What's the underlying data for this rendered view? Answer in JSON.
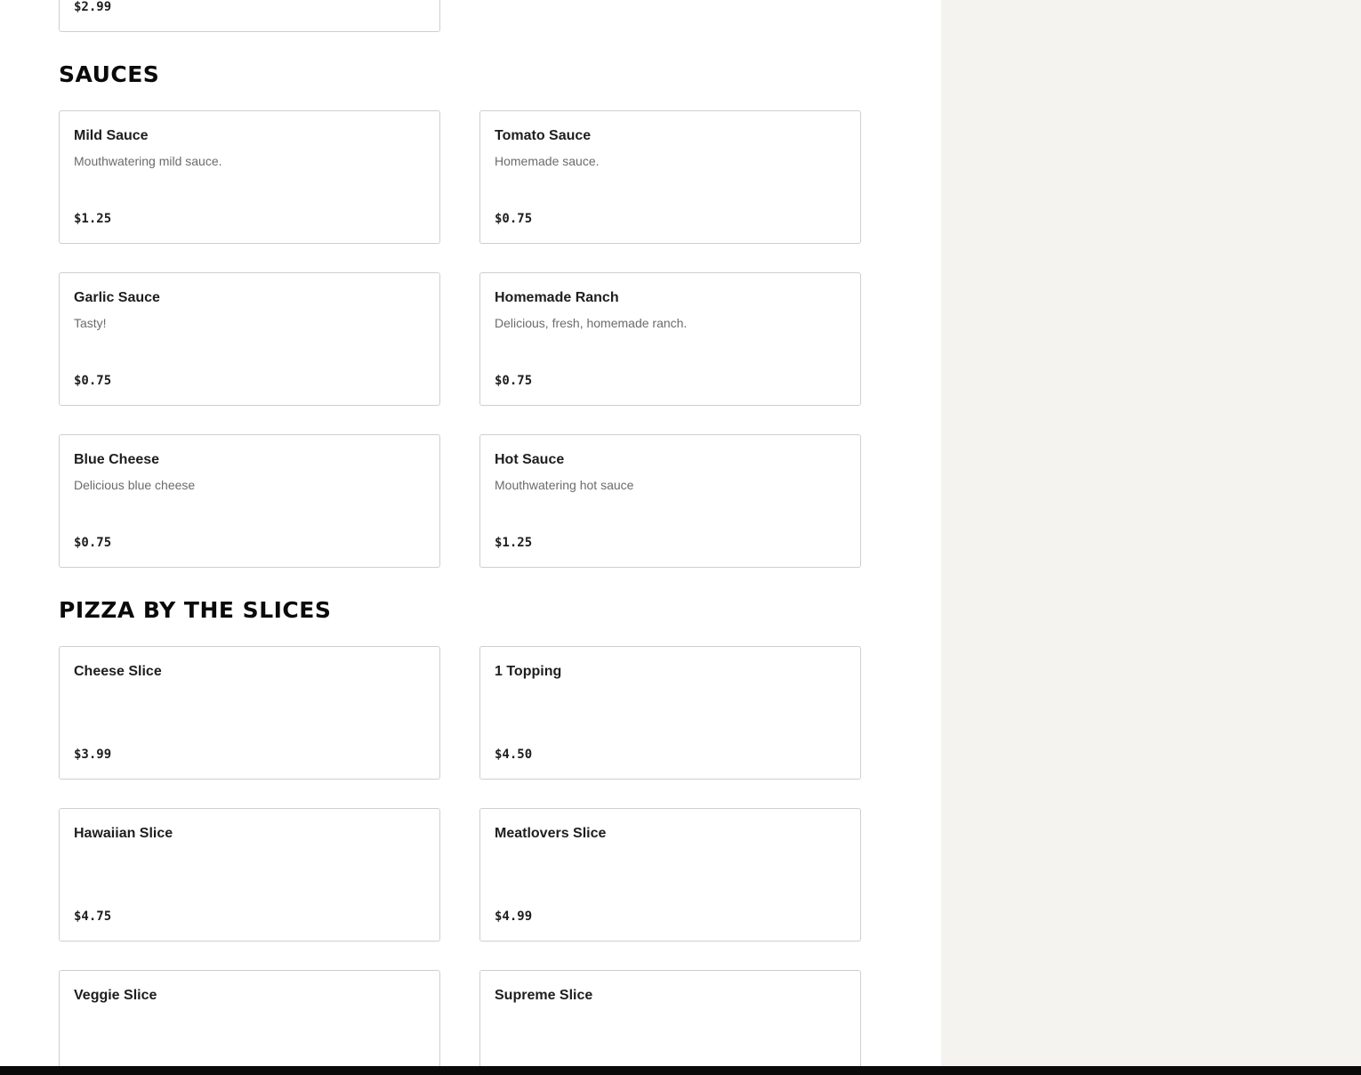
{
  "top_partial_card": {
    "price": "$2.99"
  },
  "sections": [
    {
      "title": "SAUCES",
      "items": [
        {
          "name": "Mild Sauce",
          "description": "Mouthwatering mild sauce.",
          "price": "$1.25"
        },
        {
          "name": "Tomato Sauce",
          "description": "Homemade sauce.",
          "price": "$0.75"
        },
        {
          "name": "Garlic Sauce",
          "description": "Tasty!",
          "price": "$0.75"
        },
        {
          "name": "Homemade Ranch",
          "description": "Delicious, fresh, homemade ranch.",
          "price": "$0.75"
        },
        {
          "name": "Blue Cheese",
          "description": "Delicious blue cheese",
          "price": "$0.75"
        },
        {
          "name": "Hot Sauce",
          "description": "Mouthwatering hot sauce",
          "price": "$1.25"
        }
      ]
    },
    {
      "title": "PIZZA BY THE SLICES",
      "items": [
        {
          "name": "Cheese Slice",
          "price": "$3.99"
        },
        {
          "name": "1 Topping",
          "price": "$4.50"
        },
        {
          "name": "Hawaiian Slice",
          "price": "$4.75"
        },
        {
          "name": "Meatlovers Slice",
          "price": "$4.99"
        },
        {
          "name": "Veggie Slice"
        },
        {
          "name": "Supreme Slice"
        }
      ]
    }
  ]
}
